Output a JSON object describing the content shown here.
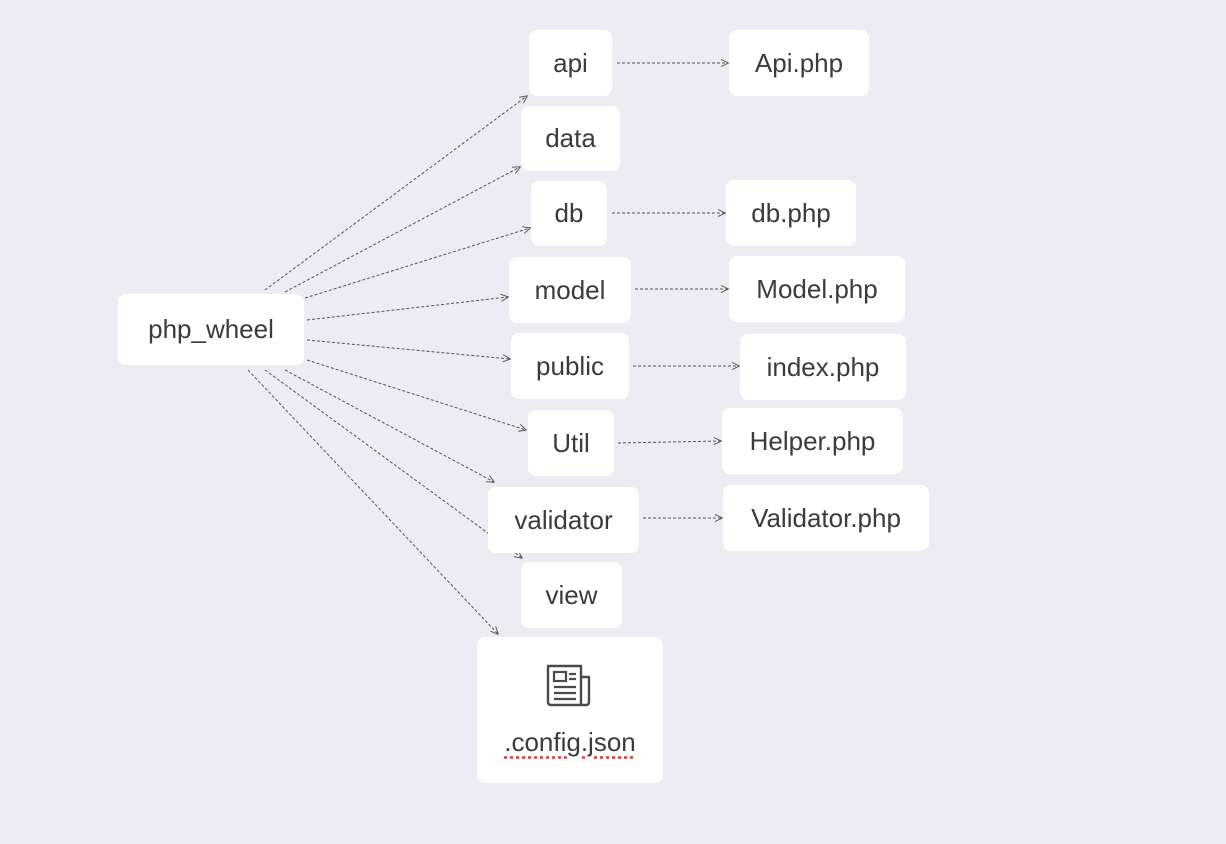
{
  "root": {
    "label": "php_wheel"
  },
  "folders": [
    {
      "id": "api",
      "label": "api"
    },
    {
      "id": "data",
      "label": "data"
    },
    {
      "id": "db",
      "label": "db"
    },
    {
      "id": "model",
      "label": "model"
    },
    {
      "id": "public",
      "label": "public"
    },
    {
      "id": "util",
      "label": "Util"
    },
    {
      "id": "validator",
      "label": "validator"
    },
    {
      "id": "view",
      "label": "view"
    }
  ],
  "config_file": {
    "label": ".config.json",
    "icon": "document-icon"
  },
  "files": [
    {
      "id": "api-php",
      "parent": "api",
      "label": "Api.php"
    },
    {
      "id": "db-php",
      "parent": "db",
      "label": "db.php"
    },
    {
      "id": "model-php",
      "parent": "model",
      "label": "Model.php"
    },
    {
      "id": "index-php",
      "parent": "public",
      "label": "index.php"
    },
    {
      "id": "helper-php",
      "parent": "util",
      "label": "Helper.php"
    },
    {
      "id": "validator-php",
      "parent": "validator",
      "label": "Validator.php"
    }
  ],
  "colors": {
    "background": "#edecf2",
    "node": "#ffffff",
    "text": "#3b3b3b",
    "edge": "#555555"
  }
}
